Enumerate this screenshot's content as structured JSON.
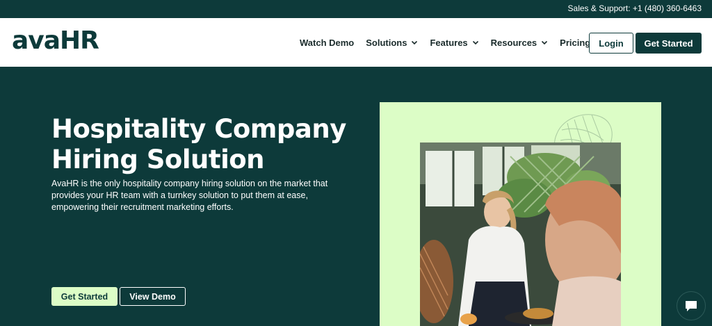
{
  "topbar": {
    "support_text": "Sales & Support: +1 (480) 360-6463"
  },
  "header": {
    "logo": "avaHR",
    "nav": [
      {
        "label": "Watch Demo",
        "has_dropdown": false
      },
      {
        "label": "Solutions",
        "has_dropdown": true
      },
      {
        "label": "Features",
        "has_dropdown": true
      },
      {
        "label": "Resources",
        "has_dropdown": true
      },
      {
        "label": "Pricing",
        "has_dropdown": false
      }
    ],
    "login_label": "Login",
    "get_started_label": "Get Started"
  },
  "hero": {
    "title": "Hospitality Company Hiring Solution",
    "description": "AvaHR is the only hospitality company hiring solution on the market that provides your HR team with a turnkey solution to put them at ease, empowering their recruitment marketing efforts.",
    "primary_button": "Get Started",
    "secondary_button": "View Demo"
  },
  "icons": {
    "chevron": "chevron-down-icon",
    "chat": "chat-bubble-icon"
  },
  "colors": {
    "brand_dark": "#0d3a3a",
    "accent_light": "#dcfdc6",
    "white": "#ffffff"
  }
}
